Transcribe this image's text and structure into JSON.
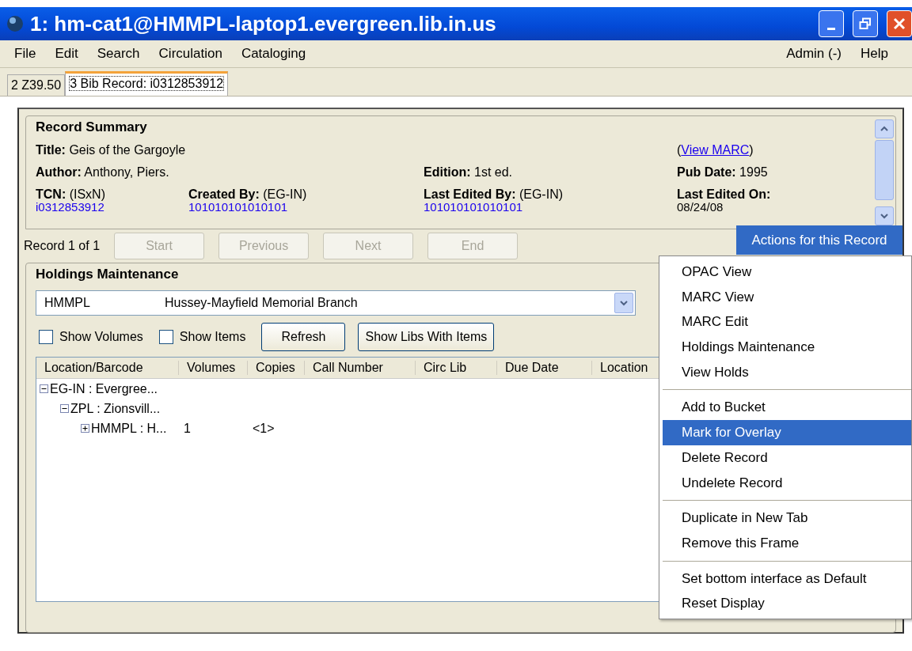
{
  "window": {
    "title": "1: hm-cat1@HMMPL-laptop1.evergreen.lib.in.us"
  },
  "menu_left": [
    "File",
    "Edit",
    "Search",
    "Circulation",
    "Cataloging"
  ],
  "menu_right": [
    "Admin (-)",
    "Help"
  ],
  "tabs": [
    {
      "label": "2 Z39.50",
      "selected": false
    },
    {
      "label": "3 Bib Record: i0312853912",
      "selected": true
    }
  ],
  "record_summary": {
    "heading": "Record Summary",
    "view_marc": {
      "before": "(",
      "link": "View MARC",
      "after": ")"
    },
    "fields": [
      {
        "label": "Title:",
        "value": "Geis of the Gargoyle"
      },
      {
        "label": "Author:",
        "value": "Anthony, Piers."
      },
      {
        "label": "Edition:",
        "value": "1st ed."
      },
      {
        "label": "Pub Date:",
        "value": "1995"
      },
      {
        "label": "TCN:",
        "value": "(ISxN)",
        "below": "i0312853912",
        "below_link": true
      },
      {
        "label": "Created By:",
        "value": "(EG-IN)",
        "below": "101010101010101",
        "below_link": true
      },
      {
        "label": "Last Edited By:",
        "value": "(EG-IN)",
        "below": "101010101010101",
        "below_link": true
      },
      {
        "label": "Last Edited On:",
        "below": "08/24/08",
        "below_link": false
      }
    ]
  },
  "record_nav": {
    "position": "Record 1 of 1",
    "buttons": [
      {
        "label": "Start",
        "disabled": true
      },
      {
        "label": "Previous",
        "disabled": true
      },
      {
        "label": "Next",
        "disabled": true
      },
      {
        "label": "End",
        "disabled": true
      }
    ]
  },
  "actions_button": {
    "label": "Actions for this Record"
  },
  "holdings": {
    "heading": "Holdings Maintenance",
    "library": {
      "code": "HMMPL",
      "name": "Hussey-Mayfield Memorial Branch"
    },
    "checkboxes": [
      {
        "label": "Show Volumes",
        "checked": false
      },
      {
        "label": "Show Items",
        "checked": false
      }
    ],
    "buttons": [
      "Refresh",
      "Show Libs With Items"
    ],
    "columns": [
      "Location/Barcode",
      "Volumes",
      "Copies",
      "Call Number",
      "Circ Lib",
      "Due Date",
      "Location"
    ],
    "tree": [
      {
        "label": "EG-IN : Evergree...",
        "expanded": true,
        "children": [
          {
            "label": "ZPL : Zionsvill...",
            "expanded": true,
            "children": [
              {
                "label": "HMMPL : H...",
                "expanded": false,
                "cells": [
                  "1",
                  "<1>"
                ]
              }
            ]
          }
        ]
      }
    ]
  },
  "actions_menu": [
    [
      {
        "label": "OPAC View",
        "selected": false
      },
      {
        "label": "MARC View",
        "selected": false
      },
      {
        "label": "MARC Edit",
        "selected": false
      },
      {
        "label": "Holdings Maintenance",
        "selected": false
      },
      {
        "label": "View Holds",
        "selected": false
      }
    ],
    [
      {
        "label": "Add to Bucket",
        "selected": false
      },
      {
        "label": "Mark for Overlay",
        "selected": true
      },
      {
        "label": "Delete Record",
        "selected": false
      },
      {
        "label": "Undelete Record",
        "selected": false
      }
    ],
    [
      {
        "label": "Duplicate in New Tab",
        "selected": false
      },
      {
        "label": "Remove this Frame",
        "selected": false
      }
    ],
    [
      {
        "label": "Set bottom interface as Default",
        "selected": false
      },
      {
        "label": "Reset Display",
        "selected": false
      }
    ]
  ]
}
